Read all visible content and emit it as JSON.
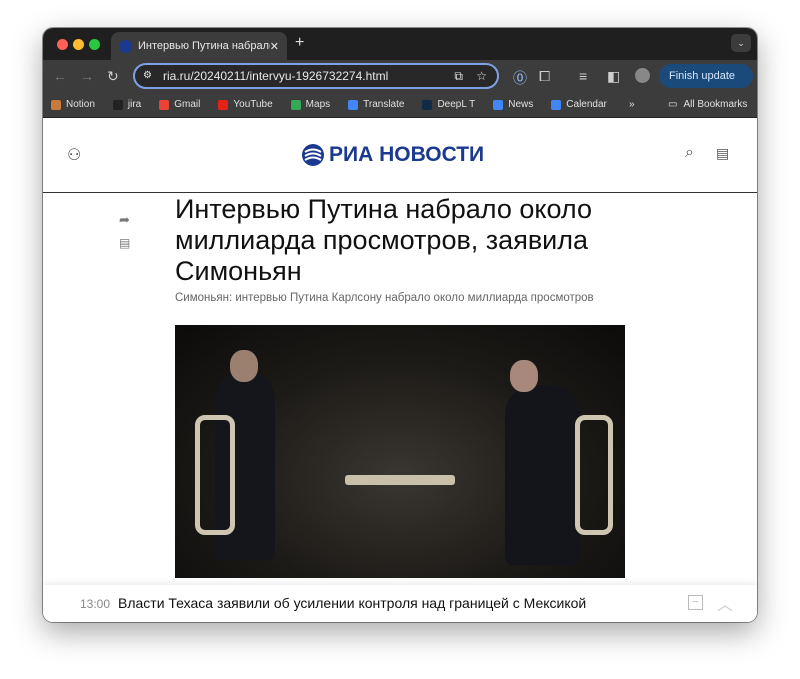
{
  "browser": {
    "tab_title": "Интервью Путина набрало о",
    "url": "ria.ru/20240211/intervyu-1926732274.html",
    "finish_update": "Finish update",
    "bookmarks": [
      {
        "label": "Notion",
        "color": "#c87a3c"
      },
      {
        "label": "jira",
        "color": "#222"
      },
      {
        "label": "Gmail",
        "color": "#ea4335"
      },
      {
        "label": "YouTube",
        "color": "#e62117"
      },
      {
        "label": "Maps",
        "color": "#34a853"
      },
      {
        "label": "Translate",
        "color": "#4285f4"
      },
      {
        "label": "DeepL T",
        "color": "#0f2b46"
      },
      {
        "label": "News",
        "color": "#4285f4"
      },
      {
        "label": "Calendar",
        "color": "#4285f4"
      }
    ],
    "all_bookmarks": "All Bookmarks"
  },
  "site": {
    "logo": "РИА НОВОСТИ",
    "brand_color": "#1b3a8f"
  },
  "article": {
    "title": "Интервью Путина набрало около миллиарда просмотров, заявила Симоньян",
    "subtitle": "Симоньян: интервью Путина Карлсону набрало около миллиарда просмотров"
  },
  "ticker": {
    "time": "13:00",
    "headline": "Власти Техаса заявили об усилении контроля над границей с Мексикой"
  }
}
